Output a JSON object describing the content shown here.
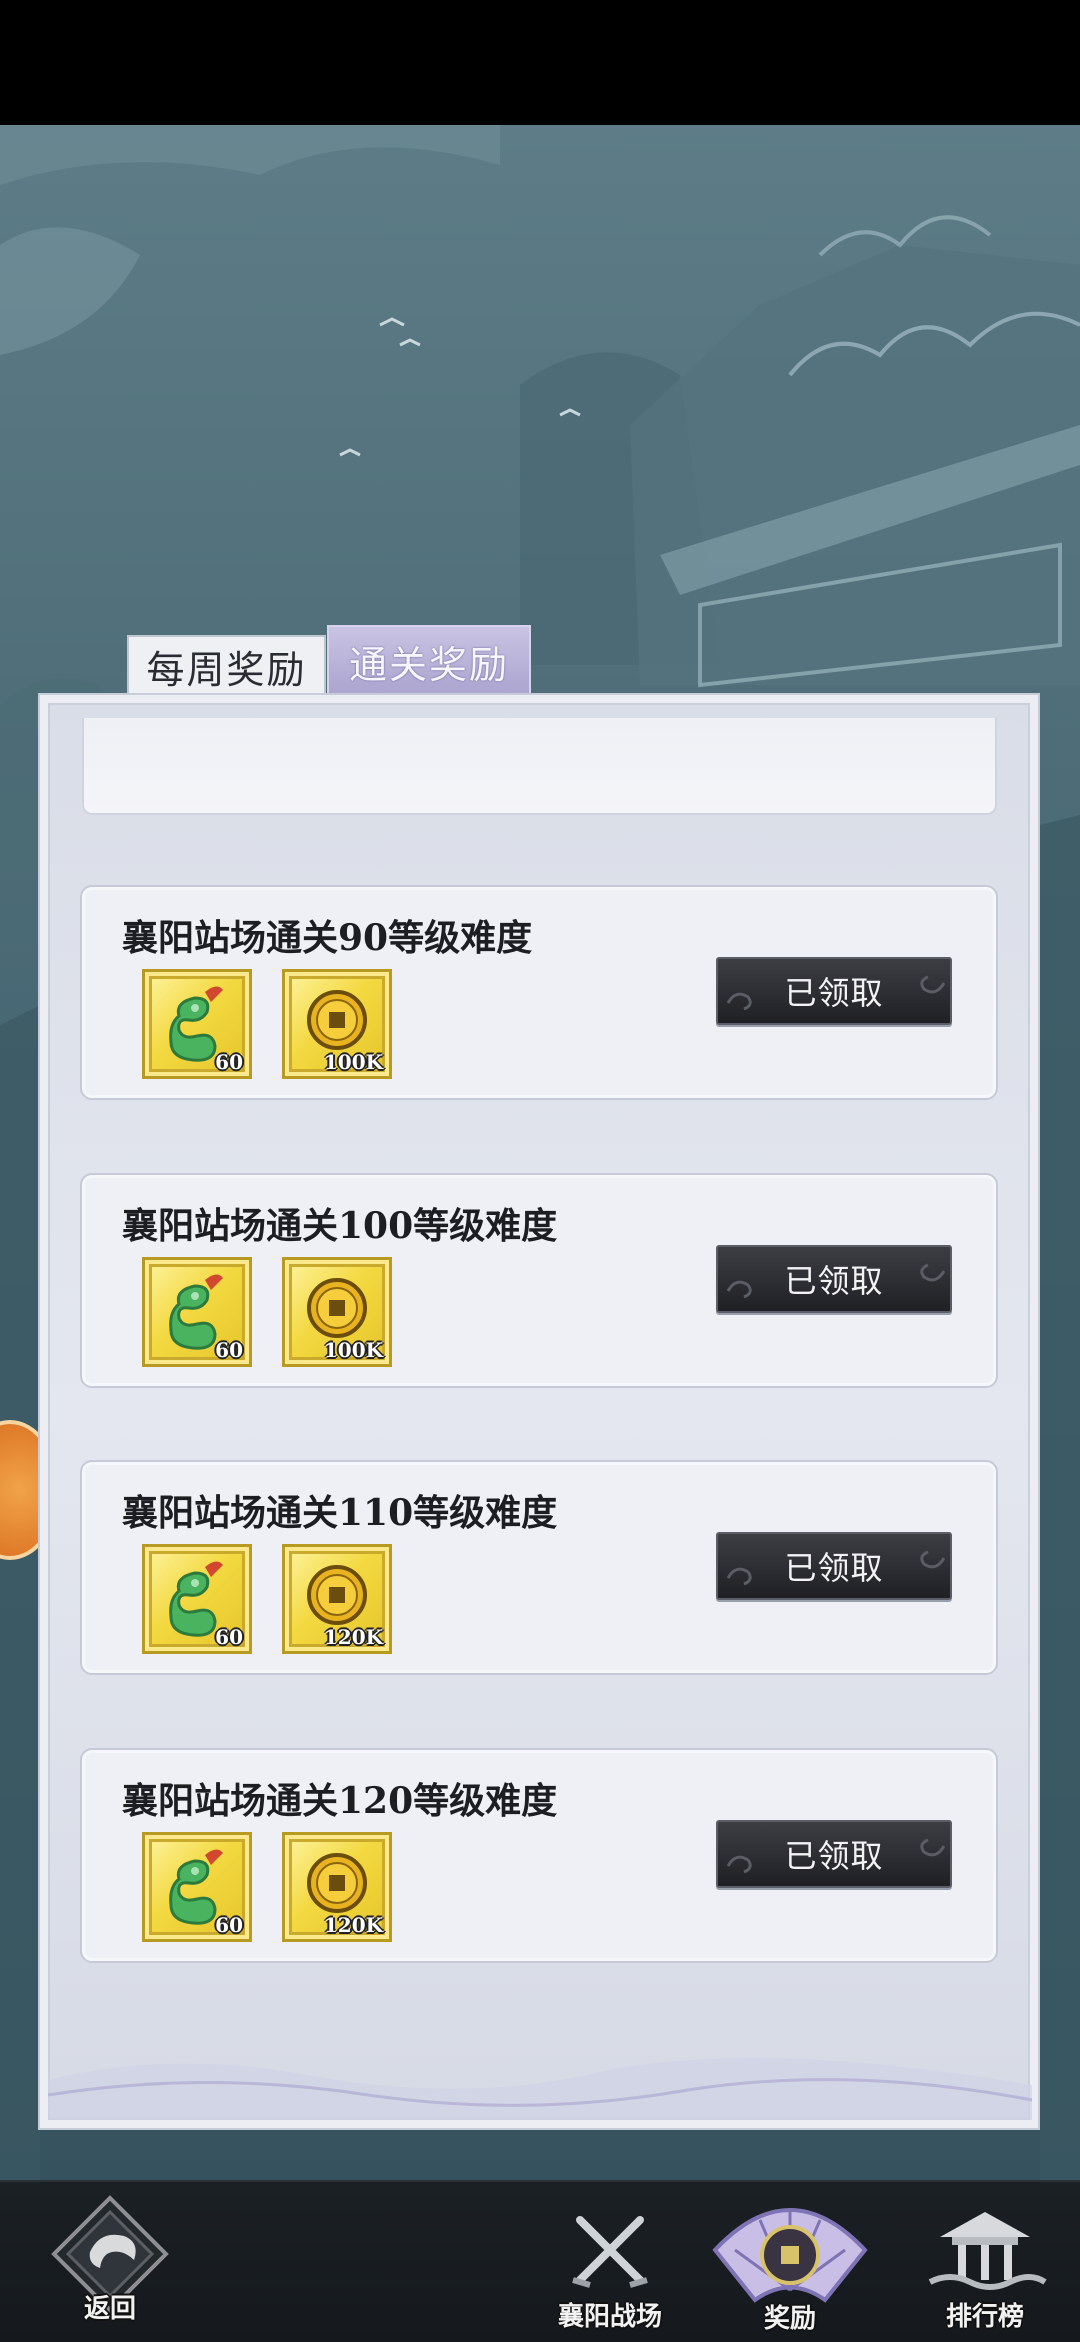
{
  "tabs": {
    "weekly": "每周奖励",
    "clear": "通关奖励"
  },
  "rewards": [
    {
      "title": "襄阳站场通关90等级难度",
      "items": [
        {
          "icon": "jade-gourd-icon",
          "count": "60"
        },
        {
          "icon": "gold-coin-icon",
          "count": "100K"
        }
      ],
      "button": "已领取"
    },
    {
      "title": "襄阳站场通关100等级难度",
      "items": [
        {
          "icon": "jade-gourd-icon",
          "count": "60"
        },
        {
          "icon": "gold-coin-icon",
          "count": "100K"
        }
      ],
      "button": "已领取"
    },
    {
      "title": "襄阳站场通关110等级难度",
      "items": [
        {
          "icon": "jade-gourd-icon",
          "count": "60"
        },
        {
          "icon": "gold-coin-icon",
          "count": "120K"
        }
      ],
      "button": "已领取"
    },
    {
      "title": "襄阳站场通关120等级难度",
      "items": [
        {
          "icon": "jade-gourd-icon",
          "count": "60"
        },
        {
          "icon": "gold-coin-icon",
          "count": "120K"
        }
      ],
      "button": "已领取"
    }
  ],
  "nav": {
    "back": "返回",
    "battlefield": "襄阳战场",
    "rewards": "奖励",
    "ranking": "排行榜"
  }
}
